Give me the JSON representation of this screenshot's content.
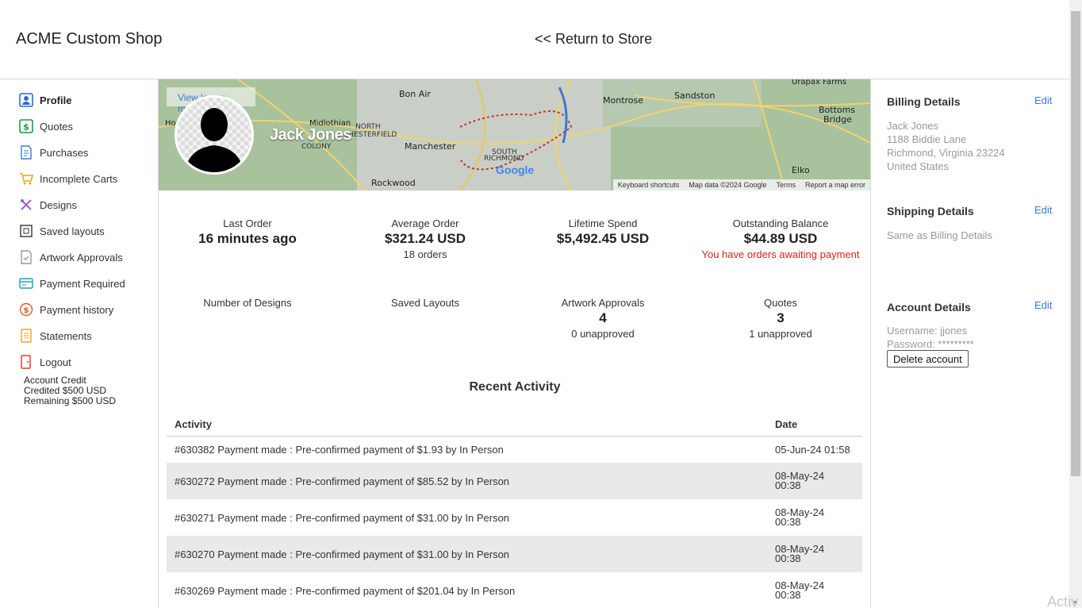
{
  "header": {
    "brand": "ACME Custom Shop",
    "return_link": "<< Return to Store"
  },
  "sidebar": {
    "items": [
      {
        "label": "Profile",
        "icon": "profile-icon",
        "active": true
      },
      {
        "label": "Quotes",
        "icon": "quotes-icon"
      },
      {
        "label": "Purchases",
        "icon": "purchases-icon"
      },
      {
        "label": "Incomplete Carts",
        "icon": "cart-icon"
      },
      {
        "label": "Designs",
        "icon": "designs-icon"
      },
      {
        "label": "Saved layouts",
        "icon": "layouts-icon"
      },
      {
        "label": "Artwork Approvals",
        "icon": "artwork-icon"
      },
      {
        "label": "Payment Required",
        "icon": "payment-required-icon"
      },
      {
        "label": "Payment history",
        "icon": "payment-history-icon"
      },
      {
        "label": "Statements",
        "icon": "statements-icon"
      },
      {
        "label": "Logout",
        "icon": "logout-icon"
      }
    ],
    "credit": {
      "title": "Account Credit",
      "credited": "Credited $500 USD",
      "remaining": "Remaining $500 USD"
    }
  },
  "map": {
    "view_link": "View larger map",
    "labels": [
      "Bon Air",
      "Montrose",
      "Sandston",
      "Midlothian",
      "North Chesterfield",
      "Manchester",
      "South Richmond",
      "Rockwood",
      "Elko",
      "Bottoms Bridge",
      "Urapax Farms",
      "Colony"
    ],
    "credits": [
      "Keyboard shortcuts",
      "Map data ©2024 Google",
      "Terms",
      "Report a map error"
    ],
    "google": "Google"
  },
  "profile": {
    "name": "Jack Jones"
  },
  "stats": {
    "last_order": {
      "label": "Last Order",
      "value": "16 minutes ago"
    },
    "average_order": {
      "label": "Average Order",
      "value": "$321.24 USD",
      "sub": "18 orders"
    },
    "lifetime_spend": {
      "label": "Lifetime Spend",
      "value": "$5,492.45 USD"
    },
    "outstanding_balance": {
      "label": "Outstanding Balance",
      "value": "$44.89 USD",
      "warning": "You have orders awaiting payment"
    },
    "designs": {
      "label": "Number of Designs"
    },
    "saved_layouts": {
      "label": "Saved Layouts"
    },
    "artwork_approvals": {
      "label": "Artwork Approvals",
      "value": "4",
      "sub": "0 unapproved"
    },
    "quotes": {
      "label": "Quotes",
      "value": "3",
      "sub": "1 unapproved"
    }
  },
  "activity": {
    "title": "Recent Activity",
    "columns": [
      "Activity",
      "Date"
    ],
    "rows": [
      {
        "activity": "#630382 Payment made : Pre-confirmed payment of $1.93 by In Person",
        "date_line1": "05-Jun-24 01:58",
        "date_line2": ""
      },
      {
        "activity": "#630272 Payment made : Pre-confirmed payment of $85.52 by In Person",
        "date_line1": "08-May-24",
        "date_line2": "00:38"
      },
      {
        "activity": "#630271 Payment made : Pre-confirmed payment of $31.00 by In Person",
        "date_line1": "08-May-24",
        "date_line2": "00:38"
      },
      {
        "activity": "#630270 Payment made : Pre-confirmed payment of $31.00 by In Person",
        "date_line1": "08-May-24",
        "date_line2": "00:38"
      },
      {
        "activity": "#630269 Payment made : Pre-confirmed payment of $201.04 by In Person",
        "date_line1": "08-May-24",
        "date_line2": "00:38"
      }
    ]
  },
  "billing": {
    "title": "Billing Details",
    "edit": "Edit",
    "lines": [
      "Jack Jones",
      "1188 Biddie Lane",
      "Richmond, Virginia 23224",
      "United States"
    ]
  },
  "shipping": {
    "title": "Shipping Details",
    "edit": "Edit",
    "text": "Same as Billing Details"
  },
  "account": {
    "title": "Account Details",
    "edit": "Edit",
    "username": "Username: jjones",
    "password": "Password: *********",
    "delete_button": "Delete account"
  },
  "watermark": "Activ",
  "colors": {
    "link": "#3b78d8",
    "warning": "#d92020",
    "row_alt": "#e9e9e9"
  }
}
